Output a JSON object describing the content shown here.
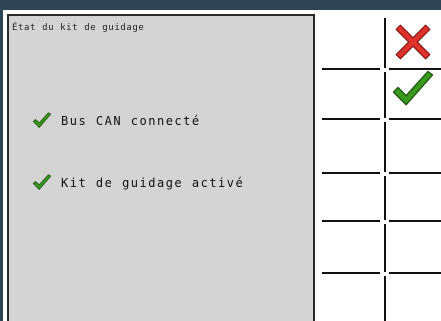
{
  "panel": {
    "title": "État du kit de guidage",
    "items": [
      {
        "label": "Bus CAN connecté",
        "icon": "check-icon",
        "color": "#3a9a1e"
      },
      {
        "label": "Kit de guidage activé",
        "icon": "check-icon",
        "color": "#3a9a1e"
      }
    ]
  },
  "softkeys": {
    "cancel": {
      "icon": "close-icon",
      "color": "#e0322c"
    },
    "confirm": {
      "icon": "check-icon",
      "color": "#3a9a1e"
    }
  },
  "colors": {
    "frame": "#2f4556",
    "panel_bg": "#d4d4d4",
    "check_green": "#3a9a1e",
    "cancel_red": "#e0322c"
  }
}
